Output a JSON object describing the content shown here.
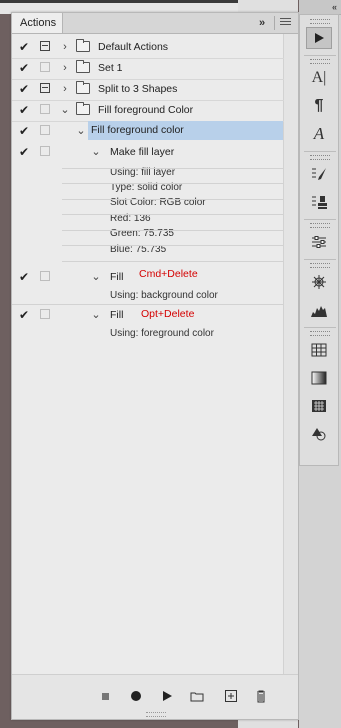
{
  "panel": {
    "tab_label": "Actions",
    "collapse_glyph": "»",
    "menu_icon": "panel-menu-icon"
  },
  "actions": [
    {
      "label": "Default Actions",
      "checked": true,
      "dialog": true,
      "expanded": false,
      "type": "set"
    },
    {
      "label": "Set 1",
      "checked": true,
      "dialog": false,
      "expanded": false,
      "type": "set"
    },
    {
      "label": "Split to 3 Shapes",
      "checked": true,
      "dialog": true,
      "expanded": false,
      "type": "set"
    },
    {
      "label": "Fill foreground Color",
      "checked": true,
      "dialog": false,
      "expanded": true,
      "type": "set"
    },
    {
      "label": "Fill foreground color",
      "checked": true,
      "dialog": false,
      "expanded": true,
      "type": "action",
      "selected": true
    }
  ],
  "steps": {
    "make_fill_layer": {
      "label": "Make fill layer",
      "details": [
        "Using: fill layer",
        "Type: solid color",
        "Slot Color: RGB color",
        "Red: 136",
        "Green: 75.735",
        "Blue: 75.735"
      ]
    },
    "fill_bg": {
      "label": "Fill",
      "note": "Cmd+Delete",
      "details": [
        "Using: background color"
      ]
    },
    "fill_fg": {
      "label": "Fill",
      "note": "Opt+Delete",
      "details": [
        "Using: foreground color"
      ]
    }
  },
  "footer": {
    "buttons": [
      "stop-icon",
      "record-icon",
      "play-icon",
      "new-set-icon",
      "new-action-icon",
      "delete-icon"
    ]
  },
  "tools": {
    "collapse_glyph": "«",
    "items": [
      "play-action-icon",
      "character-icon",
      "paragraph-icon",
      "glyphs-icon",
      "brush-presets-icon",
      "clone-source-icon",
      "adjustments-icon",
      "3d-icon",
      "histogram-icon",
      "swatches-icon",
      "gradients-icon",
      "patterns-icon",
      "shapes-icon"
    ]
  },
  "colors": {
    "note_red": "#d40000",
    "selection": "#b8d0ea",
    "background": "#6e6060"
  }
}
